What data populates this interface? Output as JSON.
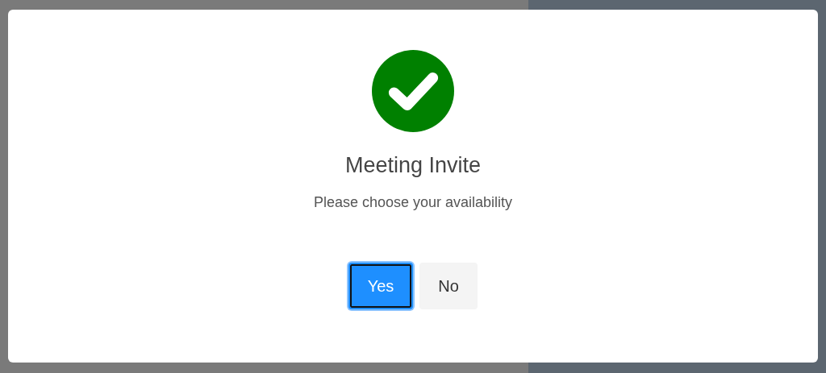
{
  "dialog": {
    "title": "Meeting Invite",
    "message": "Please choose your availability",
    "buttons": [
      {
        "label": "Yes",
        "kind": "primary",
        "selected": true
      },
      {
        "label": "No",
        "kind": "secondary",
        "selected": false
      }
    ]
  }
}
